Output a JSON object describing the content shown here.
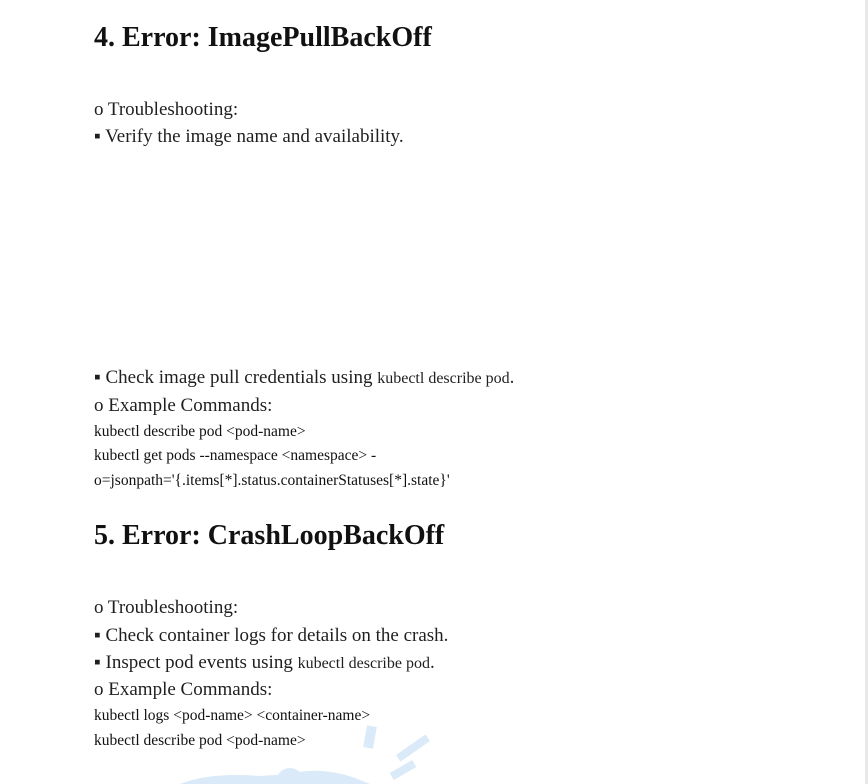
{
  "section4": {
    "heading": "4. Error: ImagePullBackOff",
    "troubleshooting_label": "o Troubleshooting:",
    "bullet1": "▪ Verify the image name and availability.",
    "bullet2_prefix": "▪ Check image pull credentials using ",
    "bullet2_cmd": "kubectl describe pod",
    "bullet2_suffix": ".",
    "example_label": "o Example Commands:",
    "commands": [
      "kubectl describe pod <pod-name>",
      "kubectl get pods --namespace <namespace> -",
      "o=jsonpath='{.items[*].status.containerStatuses[*].state}'"
    ]
  },
  "section5": {
    "heading": "5. Error: CrashLoopBackOff",
    "troubleshooting_label": "o Troubleshooting:",
    "bullet1": "▪ Check container logs for details on the crash.",
    "bullet2_prefix": "▪ Inspect pod events using ",
    "bullet2_cmd": "kubectl describe pod",
    "bullet2_suffix": ".",
    "example_label": "o Example Commands:",
    "commands": [
      "kubectl logs <pod-name> <container-name>",
      "kubectl describe pod <pod-name>"
    ]
  },
  "colors": {
    "text": "#1f1f1f",
    "heading": "#111111",
    "watermark": "#3b8fe0"
  }
}
